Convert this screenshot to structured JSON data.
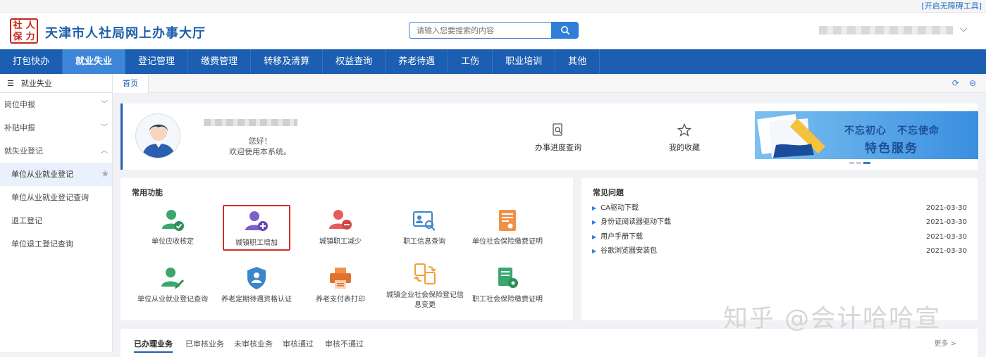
{
  "topbar": {
    "accessibility_label": "[开启无障碍工具]"
  },
  "header": {
    "logo_chars": [
      "社",
      "人",
      "保",
      "力"
    ],
    "title": "天津市人社局网上办事大厅",
    "search_placeholder": "请输入您要搜索的内容"
  },
  "nav": {
    "items": [
      "打包快办",
      "就业失业",
      "登记管理",
      "缴费管理",
      "转移及清算",
      "权益查询",
      "养老待遇",
      "工伤",
      "职业培训",
      "其他"
    ],
    "active": "就业失业"
  },
  "sidebar": {
    "heading": "就业失业",
    "groups": [
      "岗位申报",
      "补贴申报",
      "就失业登记"
    ],
    "sub_items": [
      "单位从业就业登记",
      "单位从业就业登记查询",
      "退工登记",
      "单位退工登记查询"
    ]
  },
  "tabs": {
    "home": "首页"
  },
  "welcome": {
    "greeting": "您好！",
    "message": "欢迎使用本系统。",
    "progress_query": "办事进度查询",
    "favorites": "我的收藏"
  },
  "banner": {
    "line1": "不忘初心　不忘使命",
    "line2": "特色服务"
  },
  "common": {
    "title": "常用功能",
    "functions": [
      "单位应收核定",
      "城镇职工增加",
      "城镇职工减少",
      "职工信息查询",
      "单位社会保险缴费证明",
      "单位从业就业登记查询",
      "养老定期待遇资格认证",
      "养老支付表打印",
      "城镇企业社会保险登记信息变更",
      "职工社会保险缴费证明"
    ]
  },
  "faq": {
    "title": "常见问题",
    "items": [
      {
        "label": "CA驱动下载",
        "date": "2021-03-30"
      },
      {
        "label": "身份证阅读器驱动下载",
        "date": "2021-03-30"
      },
      {
        "label": "用户手册下载",
        "date": "2021-03-30"
      },
      {
        "label": "谷歌浏览器安装包",
        "date": "2021-03-30"
      }
    ]
  },
  "business": {
    "tabs": [
      "已办理业务",
      "已审核业务",
      "未审核业务",
      "审核通过",
      "审核不通过"
    ],
    "more": "更多 >"
  },
  "watermark": "知乎 @会计哈哈宣",
  "colors": {
    "nav_bg": "#1c5fb2",
    "nav_active": "#3e87d8",
    "title_blue": "#1e5fab",
    "logo_red": "#c7261e",
    "highlight_red": "#d0302a"
  }
}
